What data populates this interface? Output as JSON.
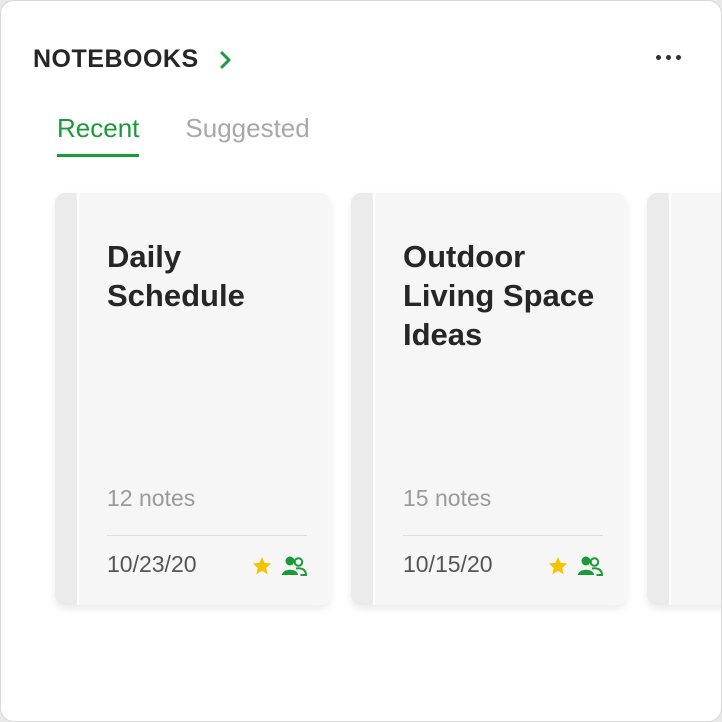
{
  "header": {
    "title": "NOTEBOOKS"
  },
  "tabs": [
    {
      "label": "Recent",
      "active": true
    },
    {
      "label": "Suggested",
      "active": false
    }
  ],
  "notebooks": [
    {
      "title": "Daily Schedule",
      "count": "12 notes",
      "date": "10/23/20"
    },
    {
      "title": "Outdoor Living Space Ideas",
      "count": "15 notes",
      "date": "10/15/20"
    }
  ],
  "colors": {
    "accent": "#1a9b3a",
    "star": "#f5c400"
  },
  "icons": [
    "chevron-right-icon",
    "more-options-icon",
    "star-icon",
    "shared-users-icon"
  ]
}
